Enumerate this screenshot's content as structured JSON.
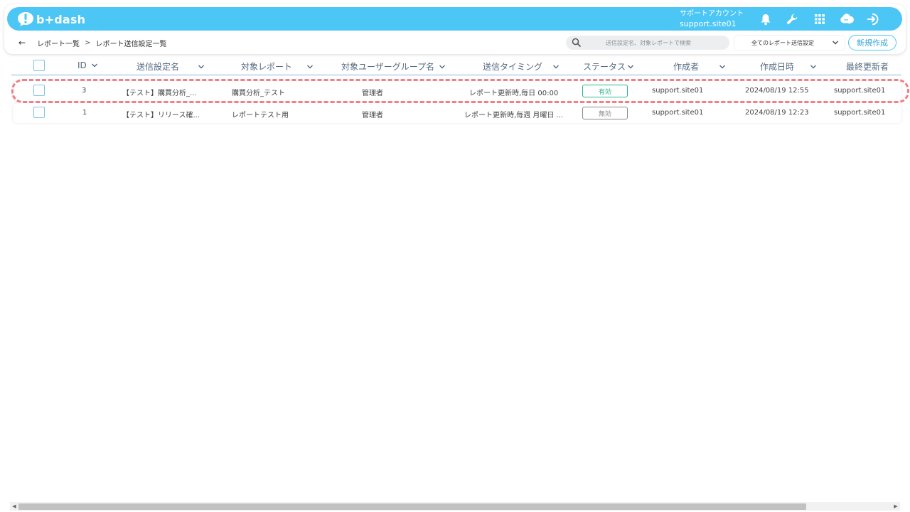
{
  "app": {
    "logo_text": "b+dash",
    "account_label": "サポートアカウント",
    "account_name": "support.site01",
    "icons": [
      "bell-icon",
      "wrench-icon",
      "grid-icon",
      "cloud-chat-icon",
      "logout-icon"
    ]
  },
  "breadcrumb": {
    "parent": "レポート一覧",
    "separator": ">",
    "current": "レポート送信設定一覧"
  },
  "search": {
    "placeholder": "送信設定名、対象レポートで検索"
  },
  "filter": {
    "selected": "全てのレポート送信設定"
  },
  "toolbar": {
    "new_label": "新規作成"
  },
  "table": {
    "columns": [
      "ID",
      "送信設定名",
      "対象レポート",
      "対象ユーザーグループ名",
      "送信タイミング",
      "ステータス",
      "作成者",
      "作成日時",
      "最終更新者"
    ],
    "rows": [
      {
        "id": "3",
        "name": "【テスト】購買分析_...",
        "report": "購買分析_テスト",
        "group": "管理者",
        "timing": "レポート更新時,毎日 00:00",
        "status": "有効",
        "creator": "support.site01",
        "created": "2024/08/19 12:55",
        "updater": "support.site01"
      },
      {
        "id": "1",
        "name": "【テスト】リリース確...",
        "report": "レポートテスト用",
        "group": "管理者",
        "timing": "レポート更新時,毎週 月曜日 ...",
        "status": "無効",
        "creator": "support.site01",
        "created": "2024/08/19 12:23",
        "updater": "support.site01"
      }
    ]
  },
  "colors": {
    "brand": "#4cc6f5",
    "status_active": "#2bb58a",
    "status_inactive": "#8a8a8a",
    "highlight": "#f07f86"
  }
}
